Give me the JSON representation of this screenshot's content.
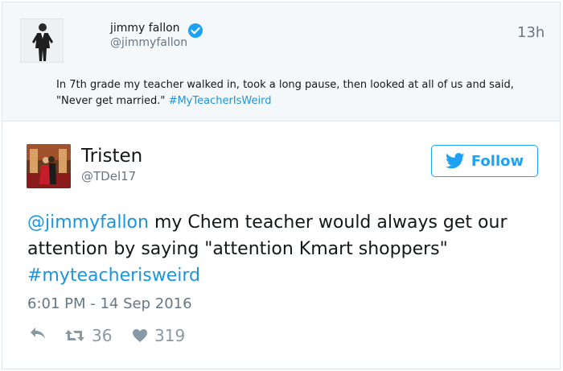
{
  "quoted": {
    "name": "jimmy fallon",
    "handle": "@jimmyfallon",
    "time": "13h",
    "text": "In 7th grade my teacher walked in, took a long pause, then looked at all of us and said, \"Never get married.\"",
    "hashtag": "#MyTeacherIsWeird"
  },
  "tweet": {
    "name": "Tristen",
    "handle": "@TDel17",
    "follow_label": "Follow",
    "mention": "@jimmyfallon",
    "text": " my Chem teacher would always get our attention by saying \"attention Kmart shoppers\"",
    "hashtag": "#myteacherisweird",
    "date": "6:01 PM - 14 Sep 2016",
    "retweets": "36",
    "likes": "319"
  },
  "colors": {
    "link": "#1b95e0",
    "brand": "#1da1f2",
    "muted": "#657786",
    "quoted_bg": "#f5f8fa"
  },
  "icons": {
    "verified": "verified-badge-icon",
    "follow": "twitter-bird-icon",
    "reply": "reply-arrow-icon",
    "retweet": "retweet-icon",
    "like": "heart-icon"
  }
}
